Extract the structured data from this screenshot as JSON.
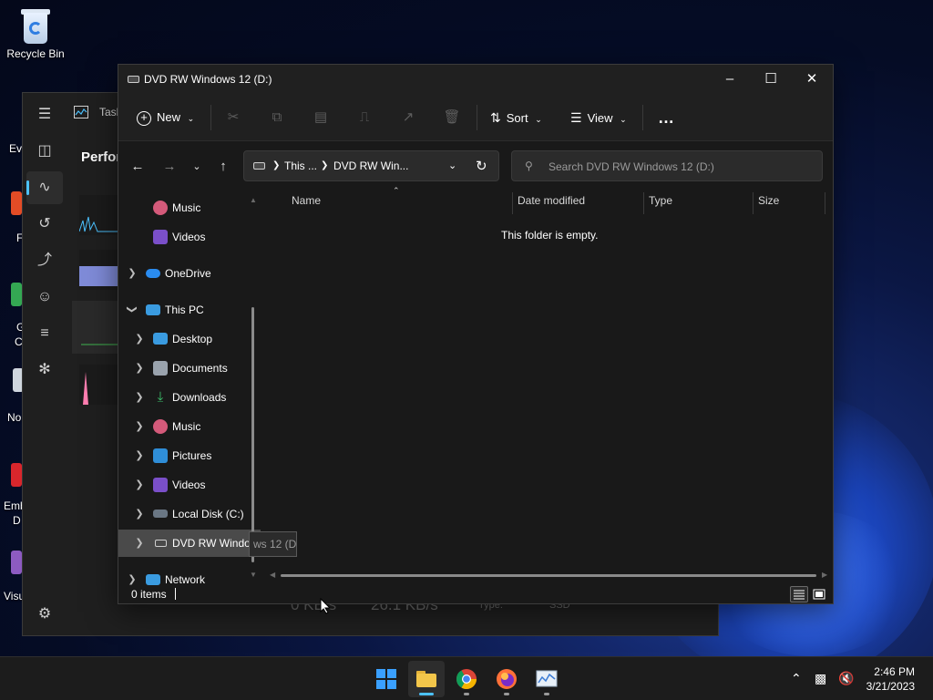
{
  "desktop": {
    "recycle_bin": "Recycle Bin",
    "fragments": [
      "Ev",
      "F",
      "G",
      "C",
      "No",
      "Emb",
      "D",
      "Visu"
    ]
  },
  "task_manager": {
    "title": "Task",
    "heading": "Perform",
    "stats": {
      "read": "0 KB/s",
      "write": "26.1 KB/s",
      "type_label": "Type:",
      "type_value": "SSD"
    }
  },
  "explorer": {
    "title": "DVD RW Windows 12 (D:)",
    "toolbar": {
      "new_label": "New",
      "sort_label": "Sort",
      "view_label": "View",
      "more_label": "…"
    },
    "address": {
      "crumbs": [
        "This ...",
        "DVD RW Win..."
      ]
    },
    "search": {
      "placeholder": "Search DVD RW Windows 12 (D:)"
    },
    "nav": [
      {
        "label": "Music",
        "expanded": false
      },
      {
        "label": "Videos",
        "expanded": false
      },
      {
        "label": "OneDrive",
        "expanded": false
      },
      {
        "label": "This PC",
        "expanded": true
      },
      {
        "label": "Desktop",
        "expanded": false
      },
      {
        "label": "Documents",
        "expanded": false
      },
      {
        "label": "Downloads",
        "expanded": false
      },
      {
        "label": "Music",
        "expanded": false
      },
      {
        "label": "Pictures",
        "expanded": false
      },
      {
        "label": "Videos",
        "expanded": false
      },
      {
        "label": "Local Disk (C:)",
        "expanded": false
      },
      {
        "label": "DVD RW Windows 12 (D:)",
        "expanded": false,
        "selected": true
      },
      {
        "label": "Network",
        "expanded": false
      }
    ],
    "tooltip": "ws 12 (D:)",
    "columns": [
      "Name",
      "Date modified",
      "Type",
      "Size"
    ],
    "empty_message": "This folder is empty.",
    "status": "0 items"
  },
  "taskbar": {
    "time": "2:46 PM",
    "date": "3/21/2023"
  },
  "colors": {
    "accent": "#4cc2ff",
    "window_bg": "#191919",
    "toolbar_bg": "#202020",
    "taskbar_bg": "#1c1c1c"
  }
}
